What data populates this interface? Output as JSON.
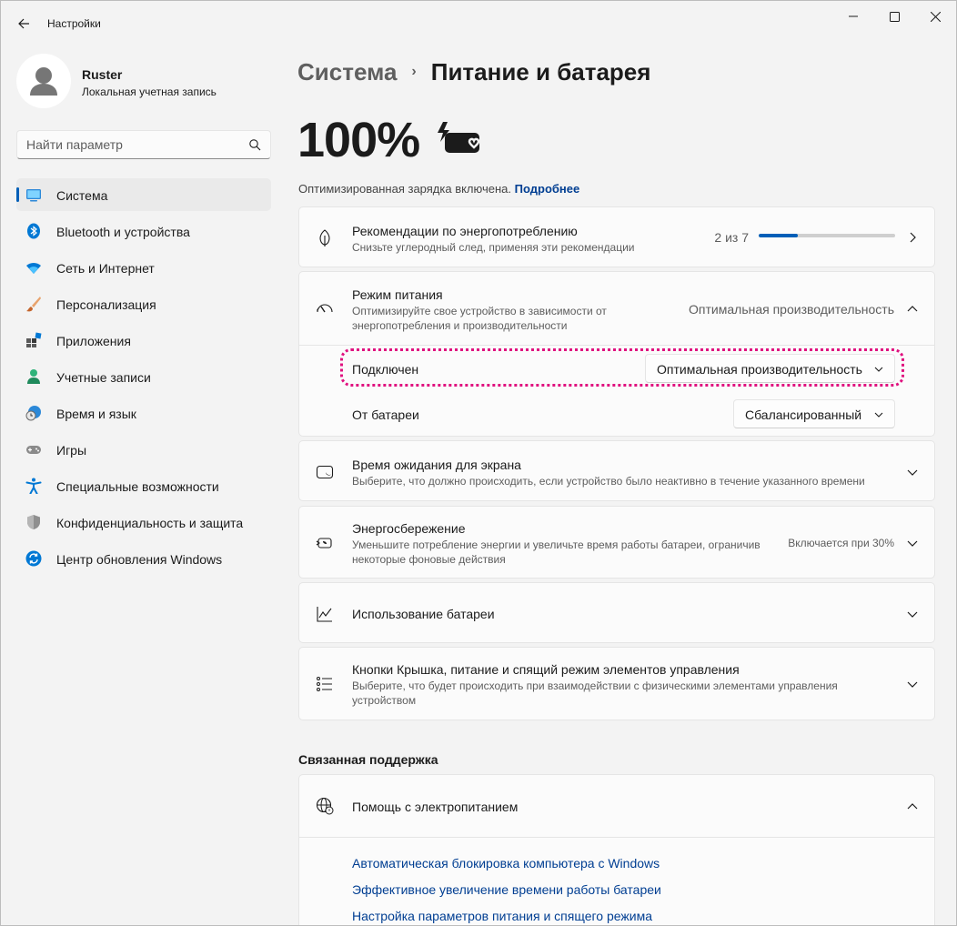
{
  "window": {
    "title": "Настройки",
    "controls": {
      "minimize": "minimize-icon",
      "maximize": "maximize-icon",
      "close": "close-icon"
    }
  },
  "profile": {
    "name": "Ruster",
    "account_type": "Локальная учетная запись"
  },
  "search": {
    "placeholder": "Найти параметр"
  },
  "sidebar": {
    "items": [
      {
        "label": "Система",
        "icon": "system-icon",
        "active": true
      },
      {
        "label": "Bluetooth и устройства",
        "icon": "bluetooth-icon"
      },
      {
        "label": "Сеть и Интернет",
        "icon": "wifi-icon"
      },
      {
        "label": "Персонализация",
        "icon": "brush-icon"
      },
      {
        "label": "Приложения",
        "icon": "apps-icon"
      },
      {
        "label": "Учетные записи",
        "icon": "accounts-icon"
      },
      {
        "label": "Время и язык",
        "icon": "time-language-icon"
      },
      {
        "label": "Игры",
        "icon": "gamepad-icon"
      },
      {
        "label": "Специальные возможности",
        "icon": "accessibility-icon"
      },
      {
        "label": "Конфиденциальность и защита",
        "icon": "shield-icon"
      },
      {
        "label": "Центр обновления Windows",
        "icon": "update-icon"
      }
    ]
  },
  "breadcrumb": {
    "parent": "Система",
    "separator": "›",
    "current": "Питание и батарея"
  },
  "battery": {
    "percent_text": "100%",
    "status_text": "Оптимизированная зарядка включена.",
    "status_link": "Подробнее"
  },
  "cards": {
    "recommendations": {
      "title": "Рекомендации по энергопотреблению",
      "subtitle": "Снизьте углеродный след, применяя эти рекомендации",
      "progress_text": "2 из 7",
      "progress_fraction": 0.2857
    },
    "power_mode": {
      "title": "Режим питания",
      "subtitle_line1": "Оптимизируйте свое устройство в зависимости от",
      "subtitle_line2": "энергопотребления и производительности",
      "value": "Оптимальная производительность",
      "plugged_in_label": "Подключен",
      "plugged_in_value": "Оптимальная производительность",
      "battery_label": "От батареи",
      "battery_value": "Сбалансированный"
    },
    "screen_timeout": {
      "title": "Время ожидания для экрана",
      "subtitle": "Выберите, что должно происходить, если устройство было неактивно в течение указанного времени"
    },
    "energy_saver": {
      "title": "Энергосбережение",
      "subtitle_line1": "Уменьшите потребление энергии и увеличьте время работы батареи, ограничив",
      "subtitle_line2": "некоторые фоновые действия",
      "value": "Включается при 30%"
    },
    "battery_usage": {
      "title": "Использование батареи"
    },
    "lid_buttons": {
      "title": "Кнопки Крышка, питание и спящий режим элементов управления",
      "subtitle_line1": "Выберите, что будет происходить при взаимодействии с физическими элементами управления",
      "subtitle_line2": "устройством"
    }
  },
  "related_support": {
    "heading": "Связанная поддержка",
    "help_title": "Помощь с электропитанием",
    "links": [
      "Автоматическая блокировка компьютера с Windows",
      "Эффективное увеличение времени работы батареи",
      "Настройка параметров питания и спящего режима"
    ]
  },
  "colors": {
    "accent": "#005fb8",
    "link": "#003e92",
    "highlight": "#e0117f"
  }
}
